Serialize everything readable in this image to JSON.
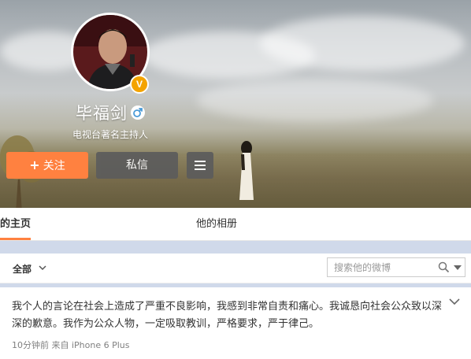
{
  "profile": {
    "name": "毕福剑",
    "description": "电视台著名主持人",
    "verified_badge": "V",
    "gender_icon": "male-icon"
  },
  "actions": {
    "follow_plus": "+",
    "follow_label": "关注",
    "message_label": "私信"
  },
  "tabs": [
    {
      "label": "的主页"
    },
    {
      "label": "他的相册"
    }
  ],
  "filter": {
    "all_label": "全部",
    "search_placeholder": "搜索他的微博"
  },
  "post": {
    "text": "我个人的言论在社会上造成了严重不良影响，我感到非常自责和痛心。我诚恳向社会公众致以深深的歉意。我作为公众人物，一定吸取教训，严格要求，严于律己。",
    "meta": "10分钟前 来自 iPhone 6 Plus"
  },
  "colors": {
    "accent": "#ff8140",
    "verified": "#f4a300",
    "gender": "#4a9bd8",
    "band": "#d0d9ea"
  }
}
